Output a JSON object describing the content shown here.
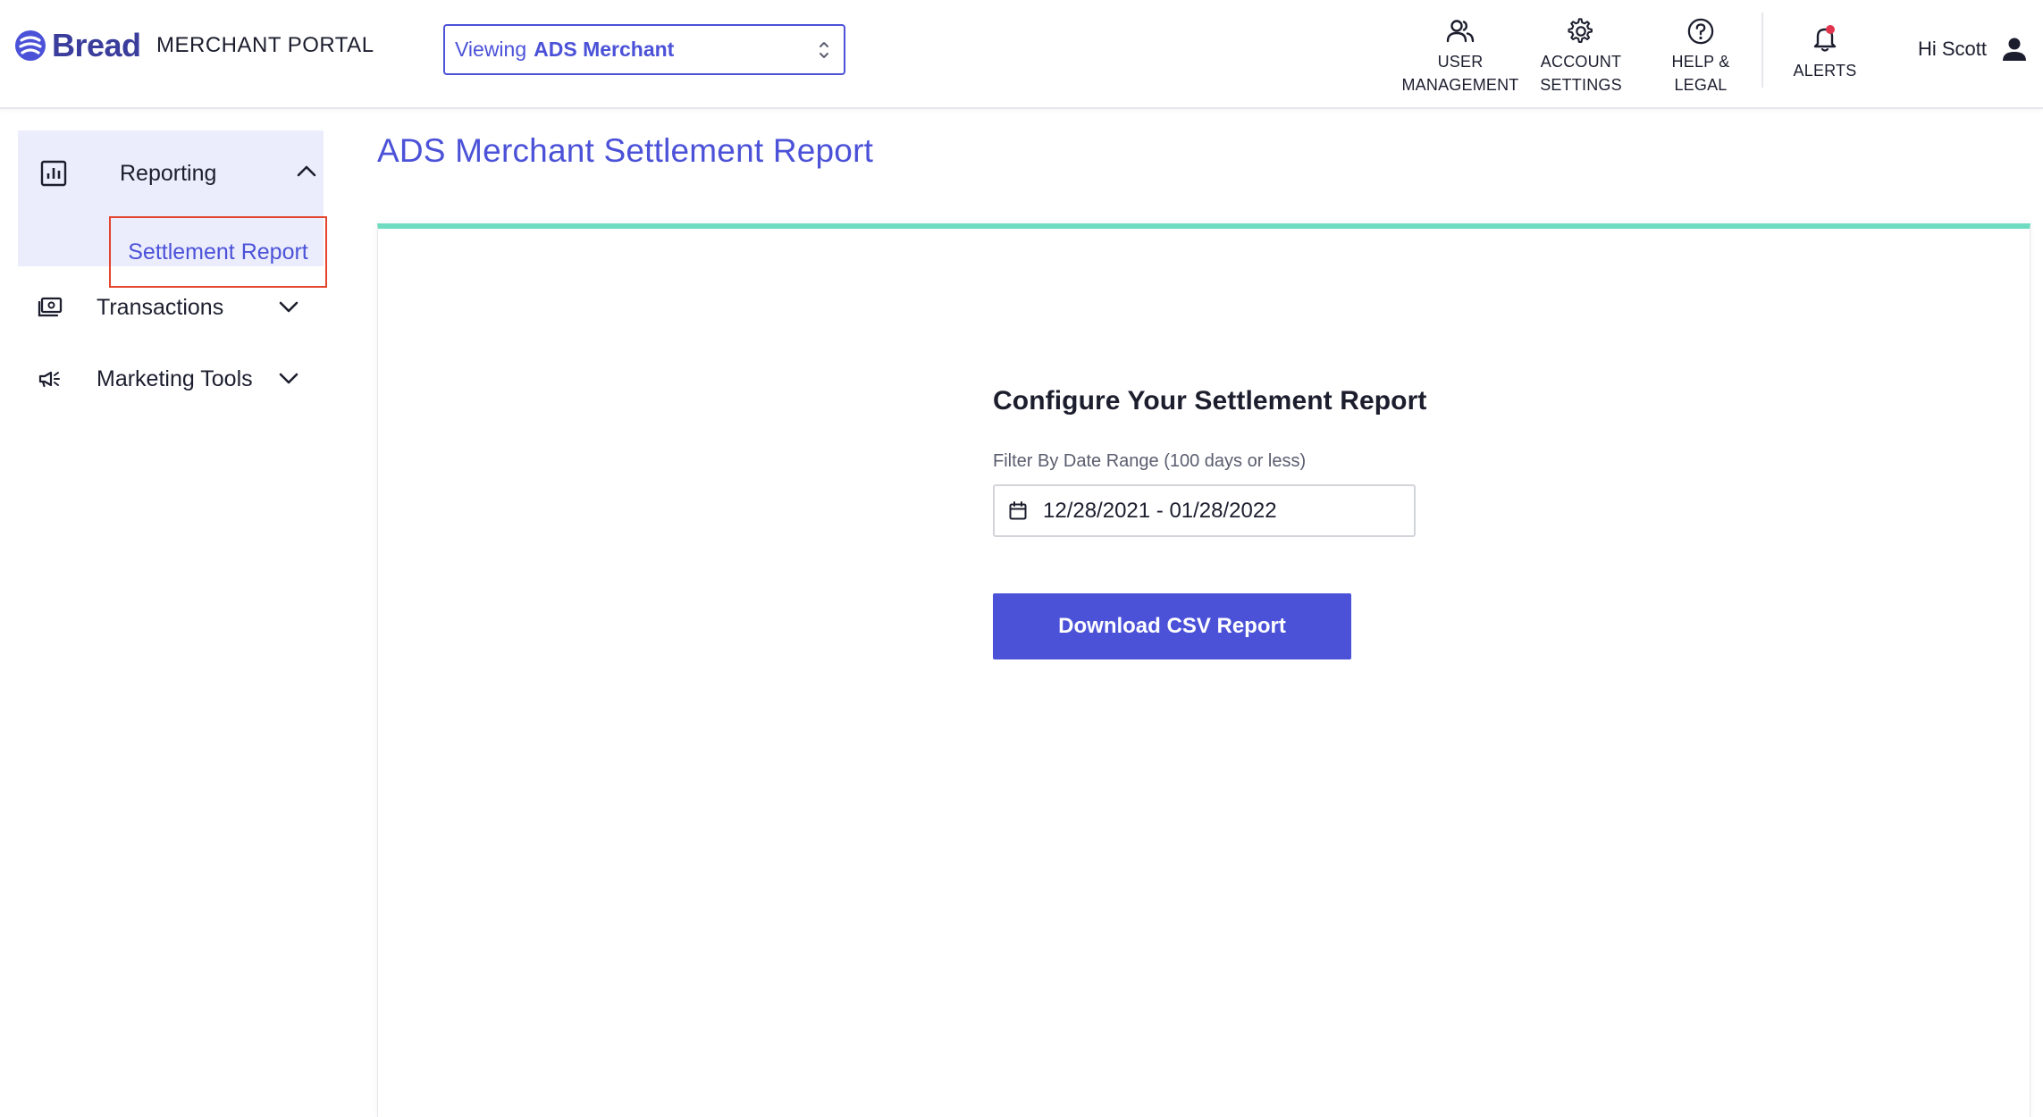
{
  "header": {
    "logo_text": "Bread",
    "portal_label": "MERCHANT PORTAL",
    "merchant_select": {
      "prefix": "Viewing",
      "value": "ADS Merchant"
    },
    "nav": {
      "user_management": {
        "line1": "USER",
        "line2": "MANAGEMENT"
      },
      "account_settings": {
        "line1": "ACCOUNT",
        "line2": "SETTINGS"
      },
      "help_legal": {
        "line1": "HELP &",
        "line2": "LEGAL"
      },
      "alerts": {
        "label": "ALERTS"
      }
    },
    "greeting": "Hi Scott"
  },
  "sidebar": {
    "reporting": {
      "label": "Reporting",
      "expanded": true,
      "sub_items": [
        "Settlement Report"
      ]
    },
    "transactions": {
      "label": "Transactions",
      "expanded": false
    },
    "marketing_tools": {
      "label": "Marketing Tools",
      "expanded": false
    }
  },
  "main": {
    "page_title": "ADS Merchant Settlement Report",
    "config_title": "Configure Your Settlement Report",
    "filter_label": "Filter By Date Range (100 days or less)",
    "date_range_value": "12/28/2021 - 01/28/2022",
    "download_button": "Download CSV Report"
  },
  "colors": {
    "brand": "#4b52d8",
    "accent_bar": "#6fdcc1",
    "sidebar_active_bg": "#ecedfc",
    "highlight_border": "#e3452f",
    "alert_dot": "#e2344c"
  },
  "icons": {
    "logo": "bread-logo-icon",
    "user_management": "users-icon",
    "account_settings": "gear-icon",
    "help_legal": "question-circle-icon",
    "alerts": "bell-icon",
    "user": "person-icon",
    "reporting": "bar-chart-icon",
    "transactions": "cash-icon",
    "marketing_tools": "megaphone-icon",
    "date_input": "calendar-icon"
  }
}
